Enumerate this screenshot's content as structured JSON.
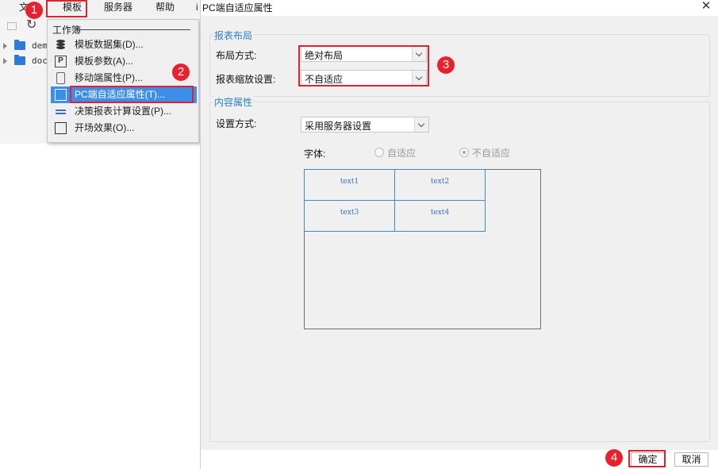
{
  "menubar": {
    "items": [
      {
        "label": "文"
      },
      {
        "label": "模板"
      },
      {
        "label": "服务器"
      },
      {
        "label": "帮助"
      },
      {
        "label": "i"
      }
    ]
  },
  "tree": {
    "items": [
      {
        "label": "dem"
      },
      {
        "label": "doc"
      }
    ]
  },
  "template_menu": {
    "section_header": "工作簿",
    "items": [
      {
        "label": "模板数据集(D)...",
        "icon": "database-icon"
      },
      {
        "label": "模板参数(A)...",
        "icon": "parameter-icon",
        "icon_glyph": "P"
      },
      {
        "label": "移动端属性(P)...",
        "icon": "mobile-icon"
      },
      {
        "label": "PC端自适应属性(T)...",
        "icon": "expand-icon",
        "selected": true
      },
      {
        "label": "决策报表计算设置(P)...",
        "icon": "lines-icon"
      },
      {
        "label": "开场效果(O)...",
        "icon": "film-icon"
      }
    ]
  },
  "dialog": {
    "title": "PC端自适应属性",
    "close_glyph": "✕",
    "report_layout": {
      "title": "报表布局",
      "layout_mode_label": "布局方式:",
      "layout_mode_value": "绝对布局",
      "scale_label": "报表缩放设置:",
      "scale_value": "不自适应"
    },
    "content_props": {
      "title": "内容属性",
      "setting_mode_label": "设置方式:",
      "setting_mode_value": "采用服务器设置",
      "font_label": "字体:",
      "font_options": [
        {
          "label": "自适应",
          "checked": false
        },
        {
          "label": "不自适应",
          "checked": true
        }
      ],
      "preview_cells": [
        "text1",
        "text2",
        "text3",
        "text4"
      ]
    },
    "ok_label": "确定",
    "cancel_label": "取消"
  },
  "annotations": {
    "markers": [
      "1",
      "2",
      "3",
      "4"
    ],
    "color": "#e8212e"
  },
  "colors": {
    "selection": "#3d8ee8",
    "group_title": "#2b7fc6",
    "highlight_box": "#e0222e",
    "folder": "#2e7bd6"
  }
}
